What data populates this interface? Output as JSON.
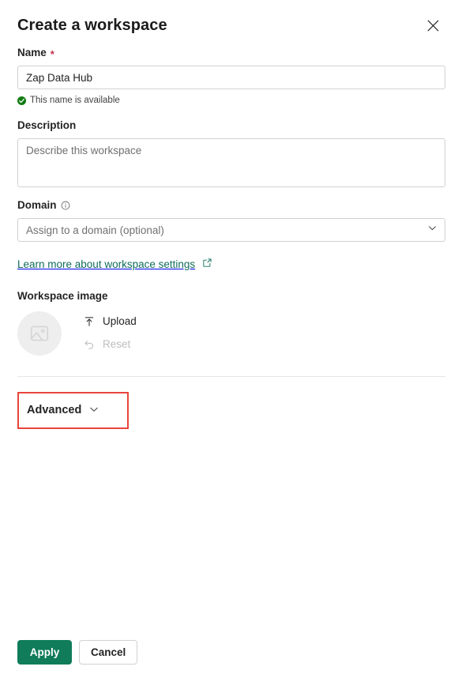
{
  "dialog": {
    "title": "Create a workspace",
    "close_label": "Close"
  },
  "name_field": {
    "label": "Name",
    "required_marker": "*",
    "value": "Zap Data Hub",
    "placeholder": "",
    "validation_message": "This name is available",
    "validation_color": "#107c10"
  },
  "description_field": {
    "label": "Description",
    "value": "",
    "placeholder": "Describe this workspace"
  },
  "domain_field": {
    "label": "Domain",
    "value": "",
    "placeholder": "Assign to a domain (optional)"
  },
  "learn_more": {
    "text": "Learn more about workspace settings",
    "color": "#0f6c5d"
  },
  "workspace_image": {
    "label": "Workspace image",
    "upload_label": "Upload",
    "reset_label": "Reset",
    "reset_disabled": true
  },
  "advanced": {
    "label": "Advanced",
    "expanded": false,
    "highlight_color": "#e8453c"
  },
  "footer": {
    "apply_label": "Apply",
    "cancel_label": "Cancel",
    "primary_color": "#107c5a"
  }
}
